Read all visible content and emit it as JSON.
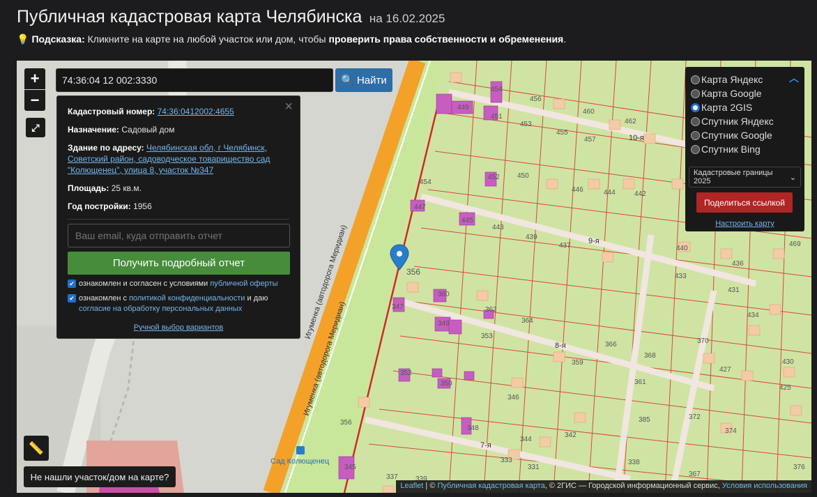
{
  "header": {
    "title": "Публичная кадастровая карта Челябинска",
    "date": "на 16.02.2025"
  },
  "hint": {
    "label": "Подсказка:",
    "text": " Кликните на карте на любой участок или дом, чтобы ",
    "bold": "проверить права собственности и обременения",
    "end": "."
  },
  "controls": {
    "zoom_in": "+",
    "zoom_out": "−",
    "fullscreen": "⤢",
    "ruler": "📏"
  },
  "search": {
    "value": "74:36:04 12 002:3330",
    "button_label": "Найти"
  },
  "popup": {
    "close": "×",
    "cadastral_label": "Кадастровый номер:",
    "cadastral_value": "74:36:0412002:4655",
    "purpose_label": "Назначение:",
    "purpose_value": "Садовый дом",
    "address_label": "Здание по адресу:",
    "address_value": "Челябинская обл, г Челябинск, Советский район, садоводческое товарищество сад \"Колющенец\", улица 8, участок №347",
    "area_label": "Площадь:",
    "area_value": "25 кв.м.",
    "year_label": "Год постройки:",
    "year_value": "1956",
    "email_placeholder": "Ваш email, куда отправить отчет",
    "report_button": "Получить подробный отчет",
    "check1_text": "ознакомлен и согласен с условиями",
    "check1_link": "публичной оферты",
    "check2_text_a": "ознакомлен с",
    "check2_link_a": "политикой конфиденциальности",
    "check2_text_b": "и даю",
    "check2_link_b": "согласие на обработку персональных данных",
    "manual_choice": "Ручной выбор вариантов"
  },
  "layers": {
    "options": [
      {
        "label": "Карта Яндекс",
        "selected": false
      },
      {
        "label": "Карта Google",
        "selected": false
      },
      {
        "label": "Карта 2GIS",
        "selected": true
      },
      {
        "label": "Спутник Яндекс",
        "selected": false
      },
      {
        "label": "Спутник Google",
        "selected": false
      },
      {
        "label": "Спутник Bing",
        "selected": false
      }
    ],
    "borders_select": "Кадастровые границы 2025",
    "share_button": "Поделиться ссылкой",
    "setup_link": "Настроить карту"
  },
  "not_found_button": "Не нашли участок/дом на карте?",
  "attribution": {
    "leaflet": "Leaflet",
    "sep": " | © ",
    "pkk": "Публичная кадастровая карта",
    "mid": ", © 2ГИС — Городской информационный сервис, ",
    "terms": "Условия использования"
  },
  "map": {
    "road_labels": [
      "Игуменка (автодорога Меридиан)",
      "Игуменка (автодорога Меридиан)"
    ],
    "street_labels": [
      "10-я",
      "9-я",
      "8-я",
      "7-я"
    ],
    "poi_label": "Сад Колющенец",
    "marker_label": "356",
    "parcel_numbers": [
      "454",
      "456",
      "460",
      "462",
      "449",
      "451",
      "453",
      "455",
      "457",
      "454",
      "452",
      "450",
      "446",
      "444",
      "442",
      "447",
      "445",
      "443",
      "439",
      "437",
      "440",
      "436",
      "469",
      "433",
      "431",
      "434",
      "360",
      "347",
      "362",
      "364",
      "349",
      "353",
      "366",
      "370",
      "368",
      "359",
      "430",
      "427",
      "425",
      "352",
      "350",
      "346",
      "361",
      "356",
      "348",
      "344",
      "342",
      "385",
      "372",
      "374",
      "333",
      "331",
      "338",
      "376",
      "345",
      "339",
      "337",
      "367"
    ],
    "colors": {
      "plots": "#cfe4a3",
      "plot_lines": "#d9483b",
      "road": "#f4a12a",
      "street": "#f0e3dc",
      "houses": "#f3cba4",
      "buildings": "#c85dc1",
      "marker": "#2a7ec8"
    }
  }
}
